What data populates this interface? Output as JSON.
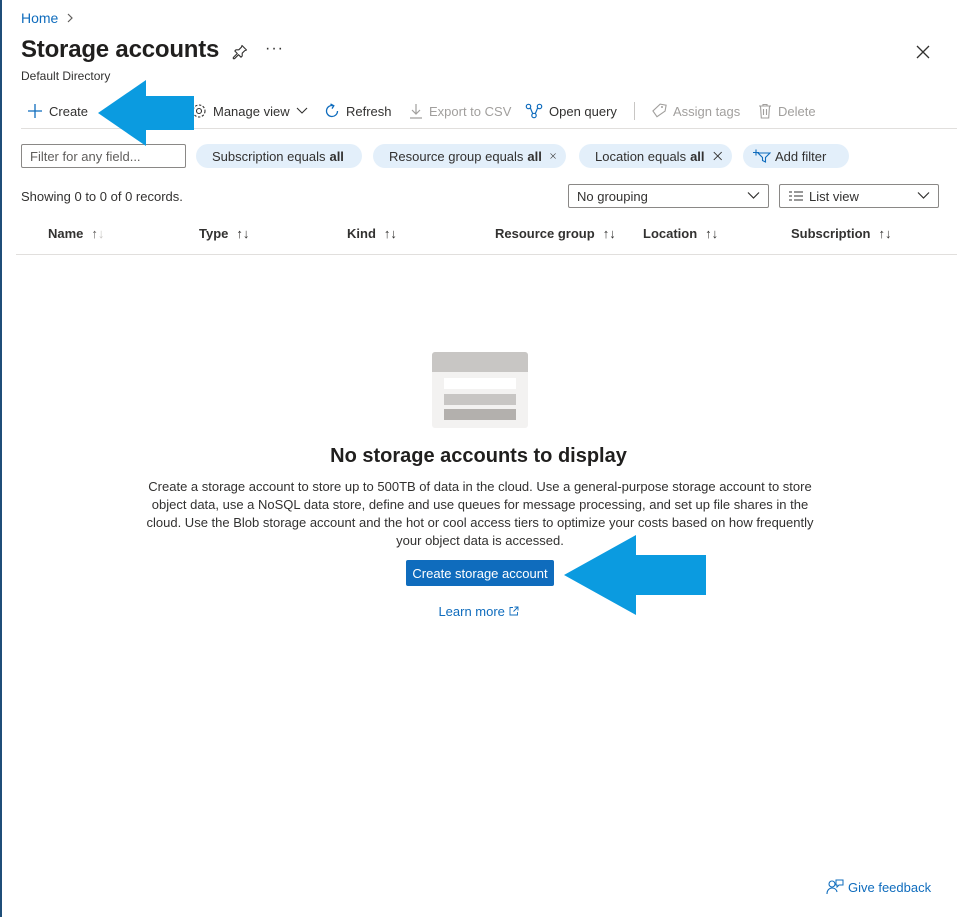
{
  "breadcrumb": {
    "home": "Home",
    "separator": ">"
  },
  "header": {
    "title": "Storage accounts",
    "subtitle": "Default Directory",
    "more": "···"
  },
  "toolbar": {
    "create": "Create",
    "manage_view": "Manage view",
    "refresh": "Refresh",
    "export_csv": "Export to CSV",
    "open_query": "Open query",
    "assign_tags": "Assign tags",
    "delete": "Delete"
  },
  "filters": {
    "placeholder": "Filter for any field...",
    "pills": [
      {
        "label": "Subscription equals",
        "value": "all"
      },
      {
        "label": "Resource group equals",
        "value": "all"
      },
      {
        "label": "Location equals",
        "value": "all"
      }
    ],
    "add_filter": "Add filter"
  },
  "records": "Showing 0 to 0 of 0 records.",
  "grouping": {
    "selected": "No grouping"
  },
  "view": {
    "selected": "List view"
  },
  "columns": [
    "Name",
    "Type",
    "Kind",
    "Resource group",
    "Location",
    "Subscription"
  ],
  "empty_state": {
    "title": "No storage accounts to display",
    "description": "Create a storage account to store up to 500TB of data in the cloud. Use a general-purpose storage account to store object data, use a NoSQL data store, define and use queues for message processing, and set up file shares in the cloud. Use the Blob storage account and the hot or cool access tiers to optimize your costs based on how frequently your object data is accessed.",
    "button": "Create storage account",
    "learn_more": "Learn more"
  },
  "feedback": "Give feedback",
  "colors": {
    "accent": "#0f6cbd",
    "pill": "#e3effa",
    "arrow": "#0b9be0"
  }
}
